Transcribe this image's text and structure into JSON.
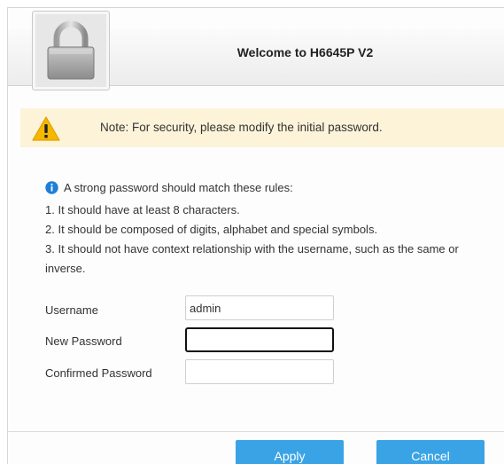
{
  "header": {
    "title": "Welcome to H6645P V2"
  },
  "note": {
    "text": "Note: For security, please modify the initial password."
  },
  "rules": {
    "intro": "A strong password should match these rules:",
    "items": [
      "1. It should have at least 8 characters.",
      "2. It should be composed of digits, alphabet and special symbols.",
      "3. It should not have context relationship with the username, such as the same or inverse."
    ]
  },
  "form": {
    "username_label": "Username",
    "username_value": "admin",
    "new_password_label": "New Password",
    "new_password_value": "",
    "confirmed_password_label": "Confirmed Password",
    "confirmed_password_value": ""
  },
  "buttons": {
    "apply": "Apply",
    "cancel": "Cancel"
  },
  "icons": {
    "header": "lock-icon",
    "note": "warning-icon",
    "rules": "info-icon"
  },
  "colors": {
    "button": "#3aa3e6",
    "note_background": "#fcf3d9",
    "warning": "#f5b800"
  }
}
